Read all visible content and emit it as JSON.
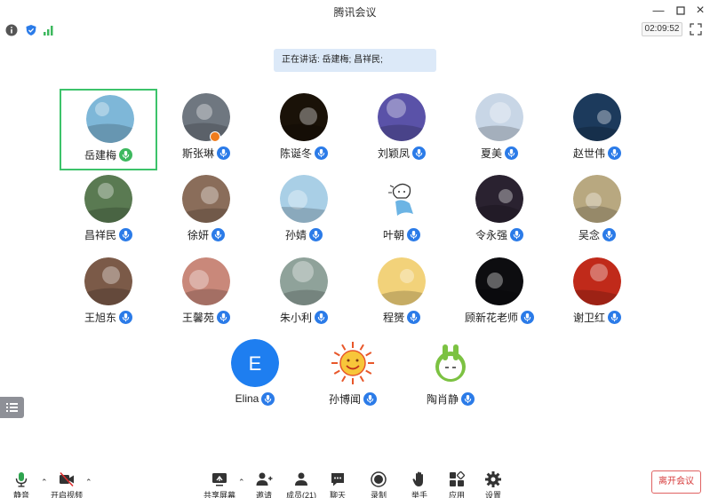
{
  "window": {
    "title": "腾讯会议"
  },
  "info_bar": {
    "timer": "02:09:52"
  },
  "speaking_banner": "正在讲话: 岳建梅; 昌祥民;",
  "participants": [
    {
      "name": "岳建梅",
      "mic": "green",
      "active": true,
      "avatar_color": "#7eb7d8"
    },
    {
      "name": "斯张琳",
      "mic": "blue",
      "badge": true,
      "avatar_color": "#6f7780"
    },
    {
      "name": "陈诞冬",
      "mic": "blue",
      "avatar_color": "#1a1208"
    },
    {
      "name": "刘颖凤",
      "mic": "blue",
      "avatar_color": "#5a52a8"
    },
    {
      "name": "夏美",
      "mic": "blue",
      "avatar_color": "#c8d6e6"
    },
    {
      "name": "赵世伟",
      "mic": "blue",
      "avatar_color": "#1c3a5c"
    },
    {
      "name": "昌祥民",
      "mic": "blue",
      "avatar_color": "#5a7a52"
    },
    {
      "name": "徐妍",
      "mic": "blue",
      "avatar_color": "#8a6d5a"
    },
    {
      "name": "孙婧",
      "mic": "blue",
      "avatar_color": "#a9cfe6"
    },
    {
      "name": "叶朝",
      "mic": "blue",
      "avatar_color": "#ffffff"
    },
    {
      "name": "令永强",
      "mic": "blue",
      "avatar_color": "#2a2230"
    },
    {
      "name": "吴念",
      "mic": "blue",
      "avatar_color": "#b8a880"
    },
    {
      "name": "王旭东",
      "mic": "blue",
      "avatar_color": "#7b5a48"
    },
    {
      "name": "王馨苑",
      "mic": "blue",
      "avatar_color": "#c9887a"
    },
    {
      "name": "朱小利",
      "mic": "blue",
      "avatar_color": "#8fa29a"
    },
    {
      "name": "程赟",
      "mic": "blue",
      "avatar_color": "#f2d27a"
    },
    {
      "name": "顾新花老师",
      "mic": "blue",
      "avatar_color": "#0d0d10"
    },
    {
      "name": "谢卫红",
      "mic": "blue",
      "avatar_color": "#c02a1a"
    },
    {
      "name": "Elina",
      "mic": "blue",
      "initial": "E",
      "avatar_color": "#1e7ef0"
    },
    {
      "name": "孙博闻",
      "mic": "blue",
      "avatar_color": "#ffffff"
    },
    {
      "name": "陶肖静",
      "mic": "blue",
      "avatar_color": "#ffffff"
    }
  ],
  "toolbar": {
    "mute": "静音",
    "video": "开启视频",
    "share": "共享屏幕",
    "invite": "邀请",
    "members": "成员(21)",
    "chat": "聊天",
    "record": "录制",
    "raise_hand": "举手",
    "apps": "应用",
    "settings": "设置",
    "leave": "离开会议"
  },
  "colors": {
    "mic_blue": "#2b7be8",
    "mic_green": "#3db85e",
    "active_border": "#3cc36a",
    "leave_red": "#d63a3a",
    "banner_bg": "#dce9f8"
  }
}
